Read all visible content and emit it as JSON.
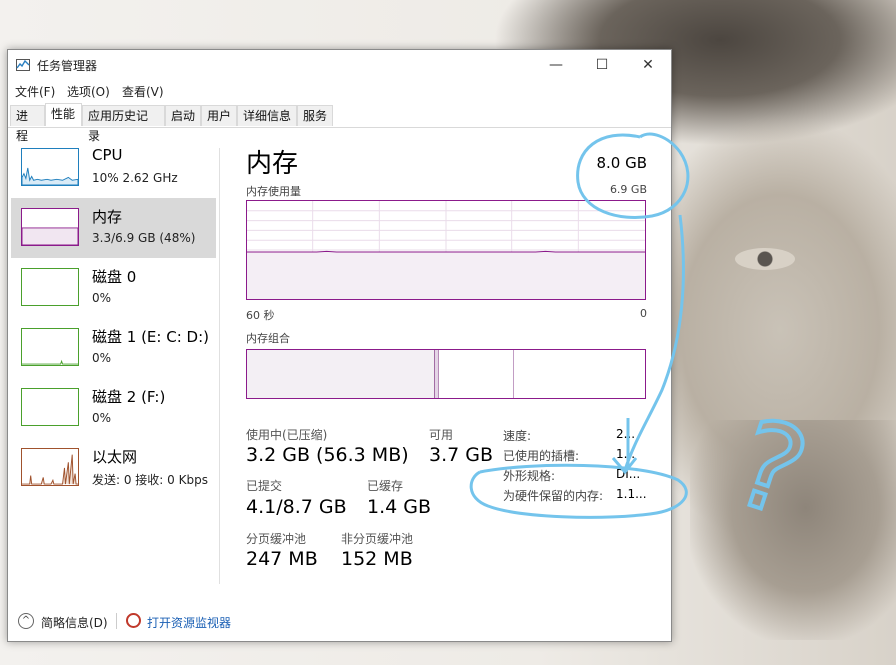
{
  "window": {
    "title": "任务管理器",
    "controls": {
      "minimize": "—",
      "maximize": "☐",
      "close": "✕"
    }
  },
  "menu": [
    "文件(F)",
    "选项(O)",
    "查看(V)"
  ],
  "tabs": [
    "进程",
    "性能",
    "应用历史记录",
    "启动",
    "用户",
    "详细信息",
    "服务"
  ],
  "active_tab": "性能",
  "sidebar": [
    {
      "name": "CPU",
      "sub": "10% 2.62 GHz",
      "color": "#1f7fbd"
    },
    {
      "name": "内存",
      "sub": "3.3/6.9 GB (48%)",
      "color": "#8b1a8b",
      "selected": true
    },
    {
      "name": "磁盘 0",
      "sub": "0%",
      "color": "#4aa02c"
    },
    {
      "name": "磁盘 1 (E: C: D:)",
      "sub": "0%",
      "color": "#4aa02c"
    },
    {
      "name": "磁盘 2 (F:)",
      "sub": "0%",
      "color": "#4aa02c"
    },
    {
      "name": "以太网",
      "sub": "发送: 0 接收: 0 Kbps",
      "color": "#a0522d"
    }
  ],
  "main": {
    "title": "内存",
    "total": "8.0 GB",
    "usage_label": "内存使用量",
    "usage_max": "6.9 GB",
    "axis_left": "60 秒",
    "axis_right": "0",
    "composition_label": "内存组合",
    "usage_fraction": 0.48
  },
  "stats": {
    "in_use_label": "使用中(已压缩)",
    "in_use_value": "3.2 GB (56.3 MB)",
    "available_label": "可用",
    "available_value": "3.7 GB",
    "committed_label": "已提交",
    "committed_value": "4.1/8.7 GB",
    "cached_label": "已缓存",
    "cached_value": "1.4 GB",
    "paged_label": "分页缓冲池",
    "paged_value": "247 MB",
    "nonpaged_label": "非分页缓冲池",
    "nonpaged_value": "152 MB"
  },
  "details": [
    {
      "label": "速度:",
      "value": "2..."
    },
    {
      "label": "已使用的插槽:",
      "value": "1..."
    },
    {
      "label": "外形规格:",
      "value": "DI..."
    },
    {
      "label": "为硬件保留的内存:",
      "value": "1.1..."
    }
  ],
  "footer": {
    "brief": "简略信息(D)",
    "monitor": "打开资源监视器"
  },
  "annotations": {
    "question_mark": "?",
    "ink_color": "#74c4ec"
  }
}
